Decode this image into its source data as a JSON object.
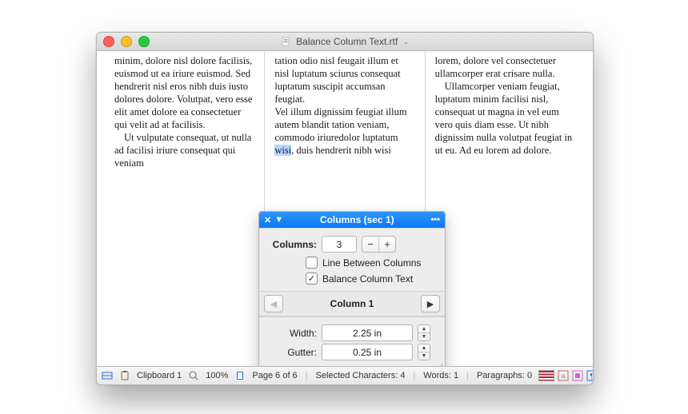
{
  "window": {
    "title": "Balance Column Text.rtf"
  },
  "document": {
    "columns": [
      {
        "paragraphs": [
          "minim, dolore nisl dolore facilisis, euismod ut ea iriure euismod. Sed hendrerit nisl eros nibh duis iusto dolores dolore. Volutpat, vero esse elit amet dolore ea consectetuer qui velit ad at facilisis.",
          "Ut vulputate consequat, ut nulla ad facilisi iriure consequat qui veniam"
        ]
      },
      {
        "paragraphs": [
          "tation odio nisl feugait illum et nisl luptatum sciurus consequat luptatum suscipit accumsan feugiat.",
          "Vel illum dignissim feugiat illum autem blandit tation veniam, commodo iriuredolor luptatum ",
          ", duis hendrerit nibh wisi"
        ],
        "selected_word": "wisi"
      },
      {
        "paragraphs": [
          "lorem, dolore vel consectetuer ullamcorper erat crisare nulla.",
          "Ullamcorper veniam feugiat, luptatum minim facilisi nisl, consequat ut magna in vel eum vero quis diam esse. Ut nibh dignissim nulla volutpat feugiat in ut eu. Ad eu lorem ad dolore."
        ]
      }
    ]
  },
  "palette": {
    "title": "Columns (sec 1)",
    "columns_label": "Columns:",
    "columns_value": "3",
    "minus": "−",
    "plus": "+",
    "line_between_label": "Line Between Columns",
    "line_between_checked": false,
    "balance_label": "Balance Column Text",
    "balance_checked": true,
    "nav_label": "Column 1",
    "width_label": "Width:",
    "width_value": "2.25 in",
    "gutter_label": "Gutter:",
    "gutter_value": "0.25 in"
  },
  "status": {
    "clipboard": "Clipboard 1",
    "zoom": "100%",
    "page": "Page 6 of 6",
    "selchars": "Selected Characters: 4",
    "words": "Words: 1",
    "paragraphs": "Paragraphs: 0"
  }
}
